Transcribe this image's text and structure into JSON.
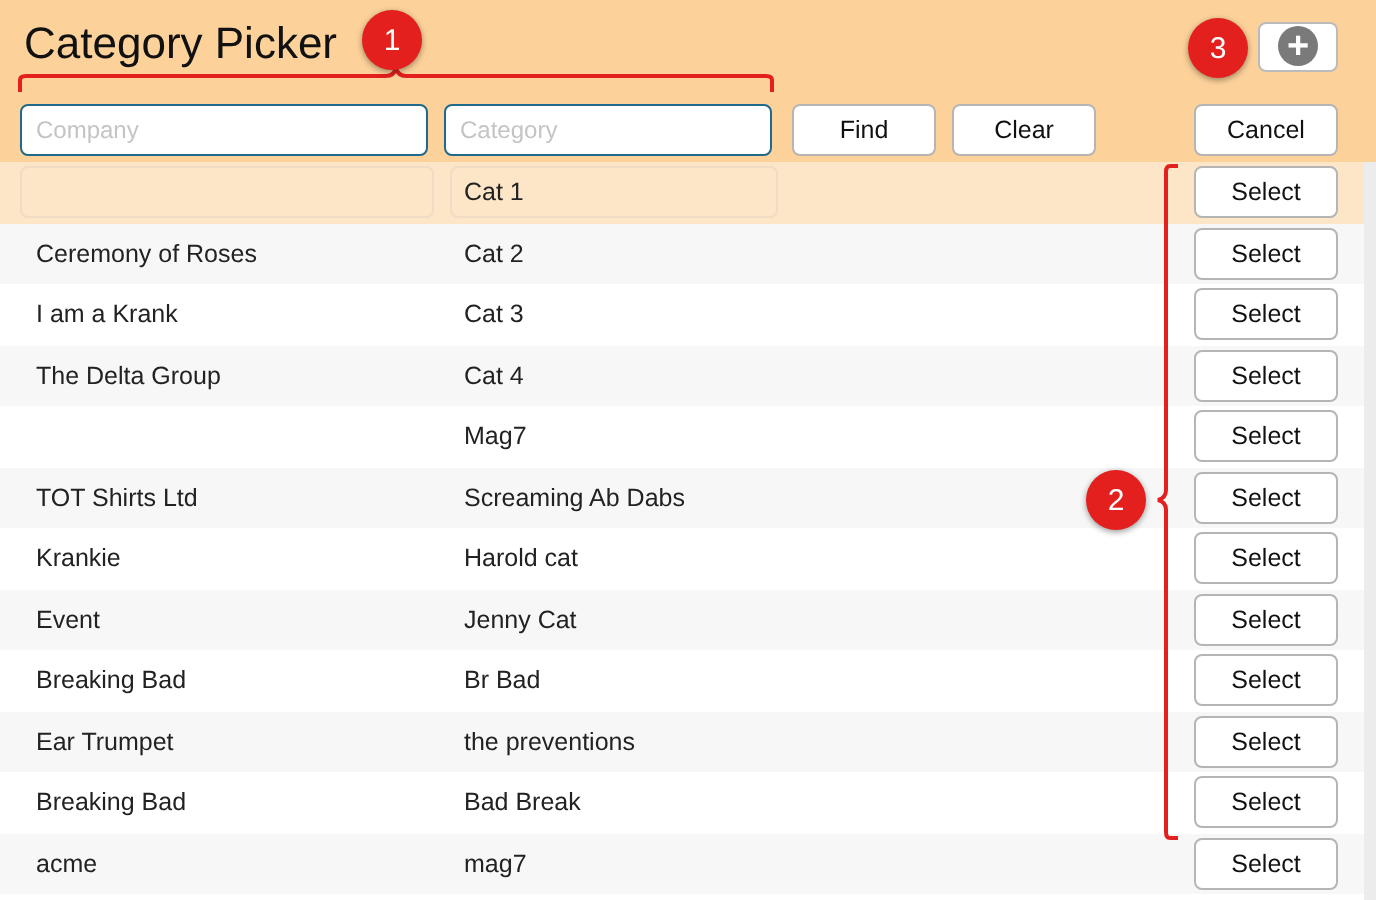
{
  "title": "Category Picker",
  "add_button": {
    "label": "+"
  },
  "search": {
    "company": {
      "placeholder": "Company"
    },
    "category": {
      "placeholder": "Category"
    }
  },
  "buttons": {
    "find": "Find",
    "clear": "Clear",
    "cancel": "Cancel"
  },
  "rows": [
    {
      "company": "",
      "category": "Cat 1",
      "action": "Select",
      "selected": true
    },
    {
      "company": "Ceremony of Roses",
      "category": "Cat 2",
      "action": "Select",
      "selected": false
    },
    {
      "company": "I am a Krank",
      "category": "Cat 3",
      "action": "Select",
      "selected": false
    },
    {
      "company": "The Delta Group",
      "category": "Cat 4",
      "action": "Select",
      "selected": false
    },
    {
      "company": "",
      "category": "Mag7",
      "action": "Select",
      "selected": false
    },
    {
      "company": "TOT Shirts Ltd",
      "category": "Screaming Ab Dabs",
      "action": "Select",
      "selected": false
    },
    {
      "company": "Krankie",
      "category": "Harold cat",
      "action": "Select",
      "selected": false
    },
    {
      "company": "Event",
      "category": "Jenny Cat",
      "action": "Select",
      "selected": false
    },
    {
      "company": "Breaking Bad",
      "category": "Br Bad",
      "action": "Select",
      "selected": false
    },
    {
      "company": "Ear Trumpet",
      "category": "the preventions",
      "action": "Select",
      "selected": false
    },
    {
      "company": "Breaking Bad",
      "category": "Bad Break",
      "action": "Select",
      "selected": false
    },
    {
      "company": "acme",
      "category": "mag7",
      "action": "Select",
      "selected": false
    }
  ],
  "callouts": [
    {
      "label": "1"
    },
    {
      "label": "2"
    },
    {
      "label": "3"
    }
  ]
}
